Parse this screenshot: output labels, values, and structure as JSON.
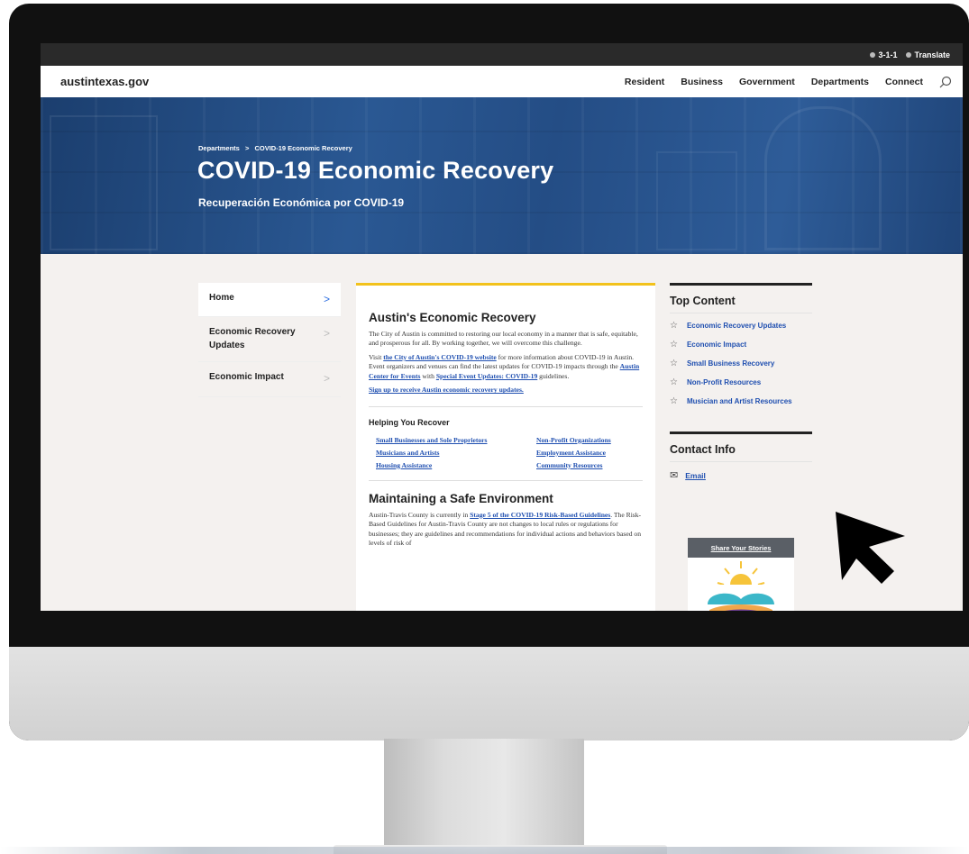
{
  "utility": {
    "phone": "3-1-1",
    "translate": "Translate"
  },
  "nav": {
    "logo": "austintexas.gov",
    "items": [
      "Resident",
      "Business",
      "Government",
      "Departments",
      "Connect"
    ]
  },
  "hero": {
    "breadcrumb": [
      "Departments",
      ">",
      "COVID-19 Economic Recovery"
    ],
    "title": "COVID-19 Economic Recovery",
    "subtitle": "Recuperación Económica por COVID-19"
  },
  "sidebar": {
    "items": [
      {
        "label": "Home",
        "chevron": ">"
      },
      {
        "label": "Economic Recovery Updates",
        "chevron": ">"
      },
      {
        "label": "Economic Impact",
        "chevron": ">"
      }
    ]
  },
  "main": {
    "heading": "Austin's Economic Recovery",
    "intro": "The City of Austin is committed to restoring our local economy in a manner that is safe, equitable, and prosperous for all. By working together, we will overcome this challenge.",
    "visit_pre": "Visit ",
    "visit_link": "the City of Austin's COVID-19 website",
    "visit_mid": " for more information about COVID-19 in Austin. Event organizers and venues can find the latest updates for COVID-19 impacts through the ",
    "visit_link2": "Austin Center for Events",
    "visit_mid2": " with ",
    "visit_link3": "Special Event Updates: COVID-19",
    "visit_post": " guidelines.",
    "signup": "Sign up to receive Austin economic recovery updates.",
    "helping_heading": "Helping You Recover",
    "helping_links": [
      "Small Businesses and Sole Proprietors",
      "Non-Profit Organizations",
      "Musicians and Artists",
      "Employment Assistance",
      "Housing Assistance",
      "Community Resources"
    ],
    "safe_heading": "Maintaining a Safe Environment",
    "safe_pre": "Austin-Travis County is currently in ",
    "safe_link": "Stage 5 of the COVID-19 Risk-Based Guidelines",
    "safe_post": ". The Risk-Based Guidelines for Austin-Travis County are not changes to local rules or regulations for businesses; they are guidelines and recommendations for individual actions and behaviors based on levels of risk of"
  },
  "aside": {
    "top_heading": "Top Content",
    "top_items": [
      "Economic Recovery Updates",
      "Economic Impact",
      "Small Business Recovery",
      "Non-Profit Resources",
      "Musician and Artist Resources"
    ],
    "contact_heading": "Contact Info",
    "contact_email": "Email",
    "stories": "Share Your Stories"
  },
  "colors": {
    "link": "#1f4fb0",
    "accent": "#f2c21c",
    "hero": "#2a5893"
  }
}
